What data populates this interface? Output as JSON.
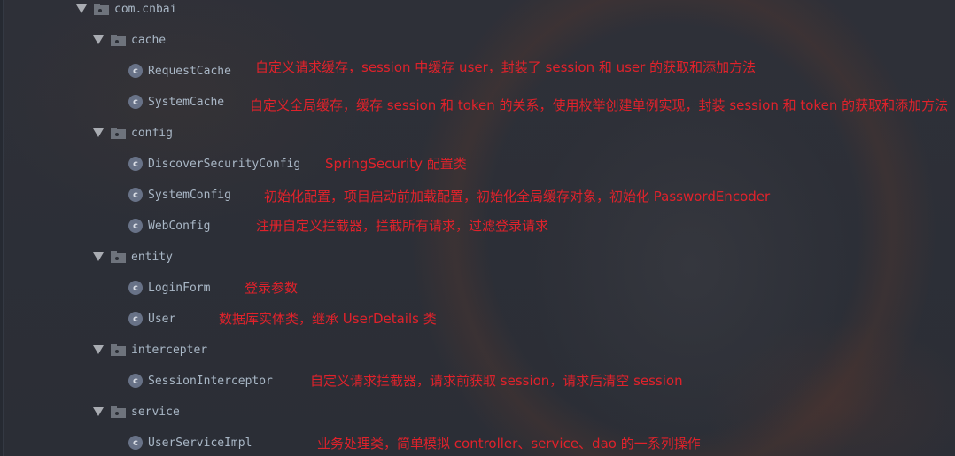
{
  "tree": {
    "root": {
      "label": "com.cnbai",
      "icon": "package-folder-icon",
      "expanded": true
    },
    "packages": [
      {
        "label": "cache",
        "expanded": true,
        "classes": [
          {
            "label": "RequestCache",
            "note": "自定义请求缓存，session 中缓存 user，封装了 session 和 user 的获取和添加方法"
          },
          {
            "label": "SystemCache",
            "note": "自定义全局缓存，缓存 session 和 token 的关系，使用枚举创建单例实现，封装 session 和 token 的获取和添加方法"
          }
        ]
      },
      {
        "label": "config",
        "expanded": true,
        "classes": [
          {
            "label": "DiscoverSecurityConfig",
            "note": "SpringSecurity 配置类"
          },
          {
            "label": "SystemConfig",
            "note": "初始化配置，项目启动前加载配置，初始化全局缓存对象，初始化 PasswordEncoder"
          },
          {
            "label": "WebConfig",
            "note": "注册自定义拦截器，拦截所有请求，过滤登录请求"
          }
        ]
      },
      {
        "label": "entity",
        "expanded": true,
        "classes": [
          {
            "label": "LoginForm",
            "note": "登录参数"
          },
          {
            "label": "User",
            "note": "数据库实体类，继承 UserDetails 类"
          }
        ]
      },
      {
        "label": "intercepter",
        "expanded": true,
        "classes": [
          {
            "label": "SessionInterceptor",
            "note": "自定义请求拦截器，请求前获取 session，请求后清空 session"
          }
        ]
      },
      {
        "label": "service",
        "expanded": true,
        "classes": [
          {
            "label": "UserServiceImpl",
            "note": "业务处理类，简单模拟 controller、service、dao 的一系列操作"
          }
        ]
      }
    ],
    "class_icon_glyph": "c",
    "colors": {
      "background": "#2c2f37",
      "tree_text": "#a9b7c6",
      "annotation_text": "#e0222b",
      "class_icon": "#687287",
      "folder_icon": "#6e737c"
    }
  }
}
